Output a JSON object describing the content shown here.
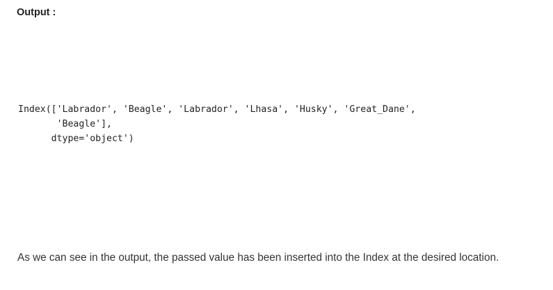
{
  "output_heading": "Output :",
  "code_output": {
    "lines": [
      "Index(['Labrador', 'Beagle', 'Labrador', 'Lhasa', 'Husky', 'Great_Dane',",
      "       'Beagle'],",
      "      dtype='object')"
    ]
  },
  "caption": "As we can see in the output, the passed value has been inserted into the Index at the desired location."
}
